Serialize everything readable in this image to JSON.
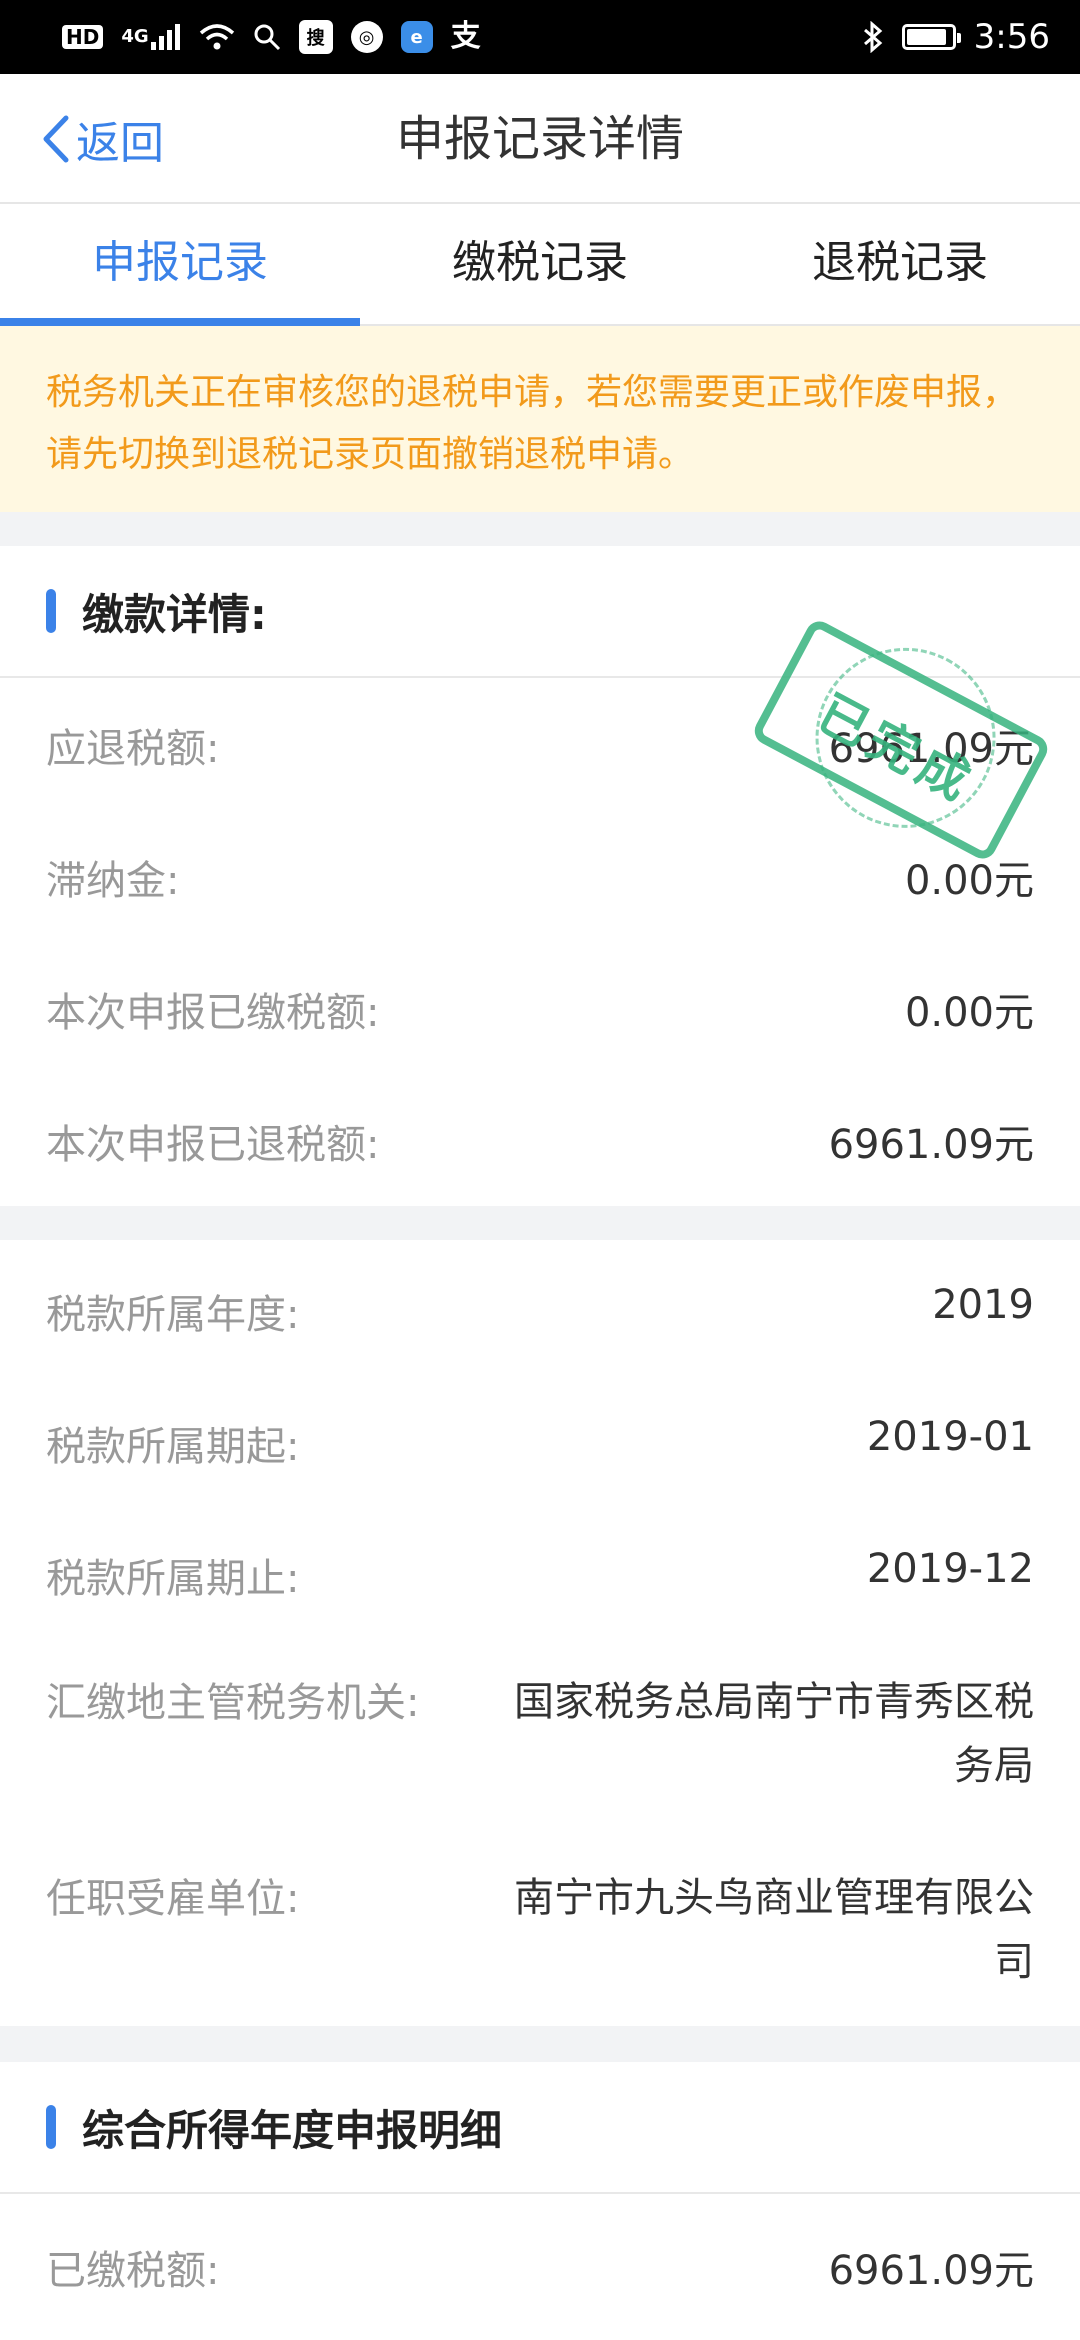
{
  "status_bar": {
    "signal": "4G",
    "hd": "HD",
    "time": "3:56",
    "battery_level": 0.9,
    "apps": [
      "sohu-icon",
      "app-icon",
      "browser-icon",
      "alipay-icon"
    ]
  },
  "nav": {
    "back_label": "返回",
    "title": "申报记录详情"
  },
  "tabs": [
    {
      "label": "申报记录"
    },
    {
      "label": "缴税记录"
    },
    {
      "label": "退税记录"
    }
  ],
  "notice": {
    "text": "税务机关正在审核您的退税申请，若您需要更正或作废申报，请先切换到退税记录页面撤销退税申请。"
  },
  "payment": {
    "title": "缴款详情:",
    "stamp_text": "已完成",
    "rows": [
      {
        "label": "应退税额:",
        "value": "6961.09元"
      },
      {
        "label": "滞纳金:",
        "value": "0.00元"
      },
      {
        "label": "本次申报已缴税额:",
        "value": "0.00元"
      },
      {
        "label": "本次申报已退税额:",
        "value": "6961.09元"
      }
    ]
  },
  "tax_info": {
    "rows": [
      {
        "label": "税款所属年度:",
        "value": "2019"
      },
      {
        "label": "税款所属期起:",
        "value": "2019-01"
      },
      {
        "label": "税款所属期止:",
        "value": "2019-12"
      },
      {
        "label": "汇缴地主管税务机关:",
        "value": "国家税务总局南宁市青秀区税务局"
      },
      {
        "label": "任职受雇单位:",
        "value": "南宁市九头鸟商业管理有限公司"
      }
    ]
  },
  "annual": {
    "title": "综合所得年度申报明细",
    "rows": [
      {
        "label": "已缴税额:",
        "value": "6961.09元"
      }
    ]
  },
  "colors": {
    "accent": "#3b82e8",
    "notice_text": "#f29a1b",
    "notice_bg": "#fff8e1",
    "stamp": "#36b37e"
  }
}
